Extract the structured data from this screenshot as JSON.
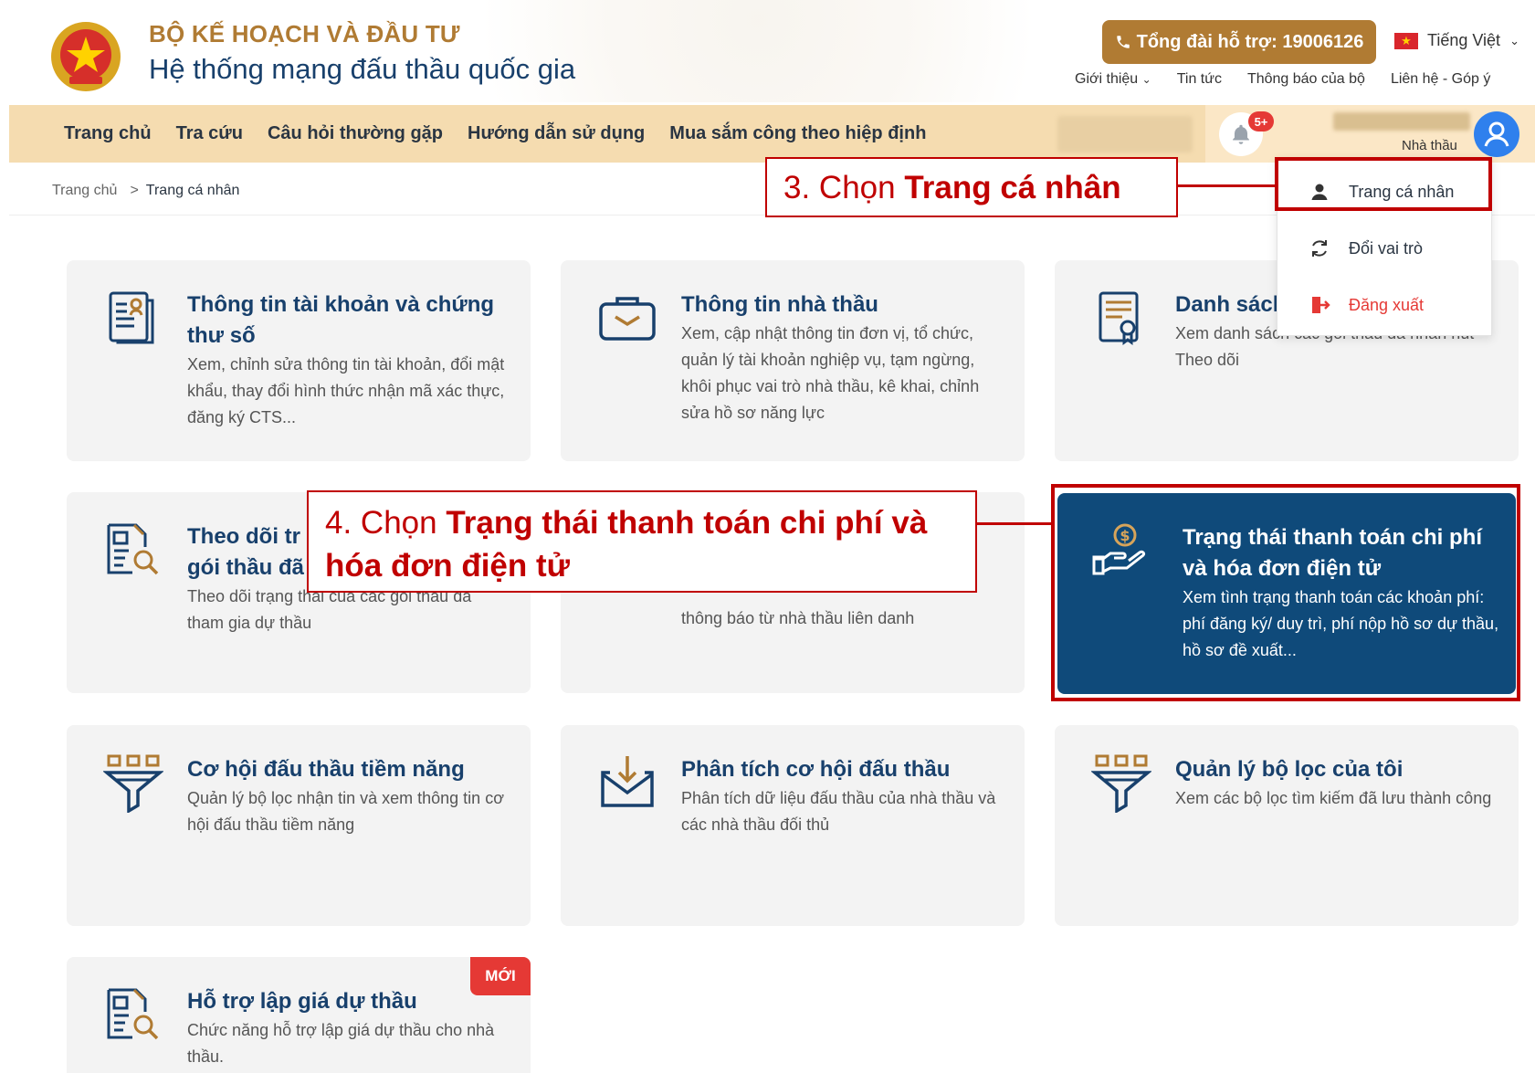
{
  "header": {
    "org_name": "BỘ KẾ HOẠCH VÀ ĐẦU TƯ",
    "system_name": "Hệ thống mạng đấu thầu quốc gia",
    "hotline": "Tổng đài hỗ trợ: 19006126",
    "language": "Tiếng Việt",
    "top_links": [
      "Giới thiệu",
      "Tin tức",
      "Thông báo của bộ",
      "Liên hệ - Góp ý"
    ]
  },
  "nav": {
    "items": [
      "Trang chủ",
      "Tra cứu",
      "Câu hỏi thường gặp",
      "Hướng dẫn sử dụng",
      "Mua sắm công theo hiệp định"
    ],
    "notification_count": "5+",
    "user_role": "Nhà thầu"
  },
  "breadcrumb": {
    "home": "Trang chủ",
    "separator": ">",
    "current": "Trang cá nhân"
  },
  "user_menu": {
    "items": [
      "Trang cá nhân",
      "Đổi vai trò",
      "Đăng xuất"
    ]
  },
  "callouts": {
    "step3_prefix": "3. Chọn ",
    "step3_bold": "Trang cá nhân",
    "step4_prefix": "4. Chọn ",
    "step4_bold": "Trạng thái thanh toán chi phí và hóa đơn điện tử"
  },
  "cards": [
    {
      "title": "Thông tin tài khoản và chứng thư số",
      "desc": "Xem, chỉnh sửa thông tin tài khoản, đổi mật khẩu, thay đổi hình thức nhận mã xác thực, đăng ký CTS..."
    },
    {
      "title": "Thông tin nhà thầu",
      "desc": "Xem, cập nhật thông tin đơn vị, tổ chức, quản lý tài khoản nghiệp vụ, tạm ngừng, khôi phục vai trò nhà thầu, kê khai, chỉnh sửa hồ sơ năng lực"
    },
    {
      "title": "Danh sácl",
      "desc": "Xem danh sách các gói thầu đã nhấn nút Theo dõi"
    },
    {
      "title": "Theo dõi tr",
      "title2": "gói thầu đã",
      "desc": "Theo dõi trạng thái của các gói thầu đã tham gia dự thầu"
    },
    {
      "desc": "thông báo từ nhà thầu liên danh"
    },
    {
      "title": "Trạng thái thanh toán chi phí và hóa đơn điện tử",
      "desc": "Xem tình trạng thanh toán các khoản phí: phí đăng ký/ duy trì, phí nộp hồ sơ dự thầu, hồ sơ đề xuất..."
    },
    {
      "title": "Cơ hội đấu thầu tiềm năng",
      "desc": "Quản lý bộ lọc nhận tin và xem thông tin cơ hội đấu thầu tiềm năng"
    },
    {
      "title": "Phân tích cơ hội đấu thầu",
      "desc": "Phân tích dữ liệu đấu thầu của nhà thầu và các nhà thầu đối thủ"
    },
    {
      "title": "Quản lý bộ lọc của tôi",
      "desc": "Xem các bộ lọc tìm kiếm đã lưu thành công"
    },
    {
      "title": "Hỗ trợ lập giá dự thầu",
      "desc": "Chức năng hỗ trợ lập giá dự thầu cho nhà thầu.",
      "badge": "MỚI"
    }
  ],
  "colors": {
    "brand_gold": "#b07b33",
    "brand_navy": "#18406c",
    "active_card": "#0f4a7a",
    "annotation_red": "#c00000"
  }
}
